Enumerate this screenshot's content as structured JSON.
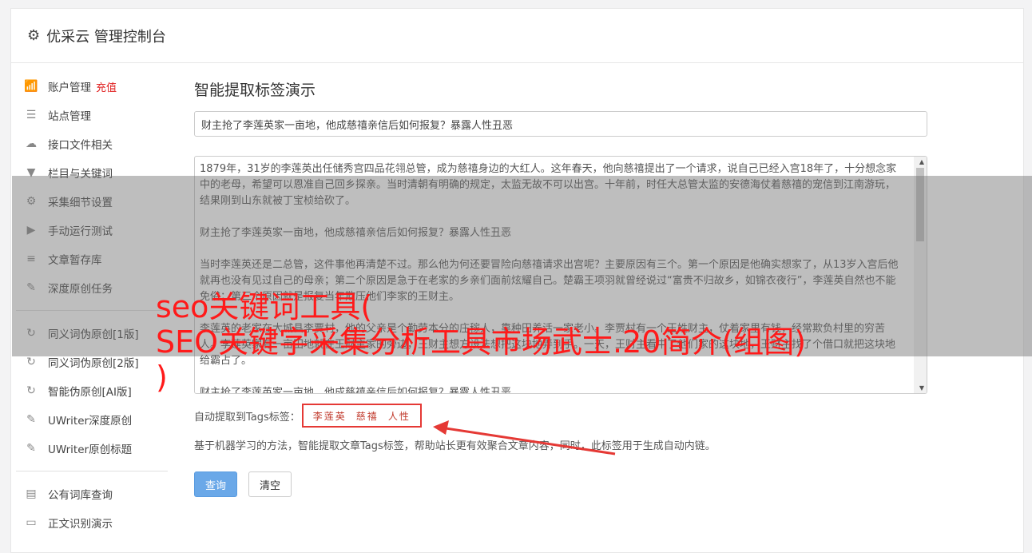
{
  "header": {
    "title": "优采云 管理控制台",
    "gear_icon": "gear-icon"
  },
  "sidebar": {
    "group1": [
      {
        "label": "账户管理",
        "extra": "充值",
        "icon": "bar-chart-icon",
        "glyph": "📶"
      },
      {
        "label": "站点管理",
        "icon": "server-icon",
        "glyph": "☰"
      },
      {
        "label": "接口文件相关",
        "icon": "cloud-upload-icon",
        "glyph": "☁"
      },
      {
        "label": "栏目与关键词",
        "icon": "filter-icon",
        "glyph": "▼"
      },
      {
        "label": "采集细节设置",
        "icon": "cogs-icon",
        "glyph": "⚙"
      },
      {
        "label": "手动运行测试",
        "icon": "play-circle-icon",
        "glyph": "▶"
      },
      {
        "label": "文章暂存库",
        "icon": "database-icon",
        "glyph": "≡"
      },
      {
        "label": "深度原创任务",
        "icon": "edit-icon",
        "glyph": "✎"
      }
    ],
    "group2": [
      {
        "label": "同义词伪原创[1版]",
        "icon": "refresh-icon",
        "glyph": "↻"
      },
      {
        "label": "同义词伪原创[2版]",
        "icon": "refresh-icon",
        "glyph": "↻"
      },
      {
        "label": "智能伪原创[AI版]",
        "icon": "refresh-icon",
        "glyph": "↻"
      },
      {
        "label": "UWriter深度原创",
        "icon": "edit-icon",
        "glyph": "✎"
      },
      {
        "label": "UWriter原创标题",
        "icon": "edit-icon",
        "glyph": "✎"
      }
    ],
    "group3": [
      {
        "label": "公有词库查询",
        "icon": "book-icon",
        "glyph": "▤"
      },
      {
        "label": "正文识别演示",
        "icon": "window-icon",
        "glyph": "▭"
      }
    ]
  },
  "main": {
    "heading": "智能提取标签演示",
    "title_value": "财主抢了李莲英家一亩地，他成慈禧亲信后如何报复？暴露人性丑恶",
    "body_paragraphs": [
      "1879年，31岁的李莲英出任储秀宫四品花翎总管，成为慈禧身边的大红人。这年春天，他向慈禧提出了一个请求，说自己已经入宫18年了，十分想念家中的老母，希望可以恩准自己回乡探亲。当时清朝有明确的规定，太监无故不可以出宫。十年前，时任大总管太监的安德海仗着慈禧的宠信到江南游玩，结果刚到山东就被丁宝桢给砍了。",
      "财主抢了李莲英家一亩地，他成慈禧亲信后如何报复？暴露人性丑恶",
      "当时李莲英还是二总管，这件事他再清楚不过。那么他为何还要冒险向慈禧请求出宫呢？主要原因有三个。第一个原因是他确实想家了，从13岁入宫后他就再也没有见过自己的母亲；第二个原因是急于在老家的乡亲们面前炫耀自己。楚霸王项羽就曾经说过“富贵不归故乡，如锦衣夜行”，李莲英自然也不能免俗；第三个原因就是报复当年欺压他们李家的王财主。",
      "李莲英的老家在大城县李贾村，他的父亲是个勤劳本分的庄稼人，靠种田养活一家老小。李贾村有一个王姓财主，仗着家里有钱，经常欺负村里的穷苦人。李莲英家有一亩田地就在王财主家的旁边，王财主想方设法想把这块地弄到手。一天，王财主看中了他们家的这块地，王财主找了个借口就把这块地给霸占了。",
      "财主抢了李莲英家一亩地，他成慈禧亲信后如何报复？暴露人性丑恶"
    ],
    "tags_label": "自动提取到Tags标签：",
    "tags": [
      "李莲英",
      "慈禧",
      "人性"
    ],
    "description": "基于机器学习的方法，智能提取文章Tags标签，帮助站长更有效聚合文章内容，同时，此标签用于生成自动内链。",
    "query_button": "查询",
    "clear_button": "清空"
  },
  "overlay": {
    "line1": "seo关键词工具(",
    "line2": "SEO关键字采集分析工具市场武士.20简介(组图)",
    "line3": ")"
  },
  "colors": {
    "overlay_text": "#ff1a1a",
    "tag_border": "#e53935",
    "primary": "#6aa8e8"
  }
}
